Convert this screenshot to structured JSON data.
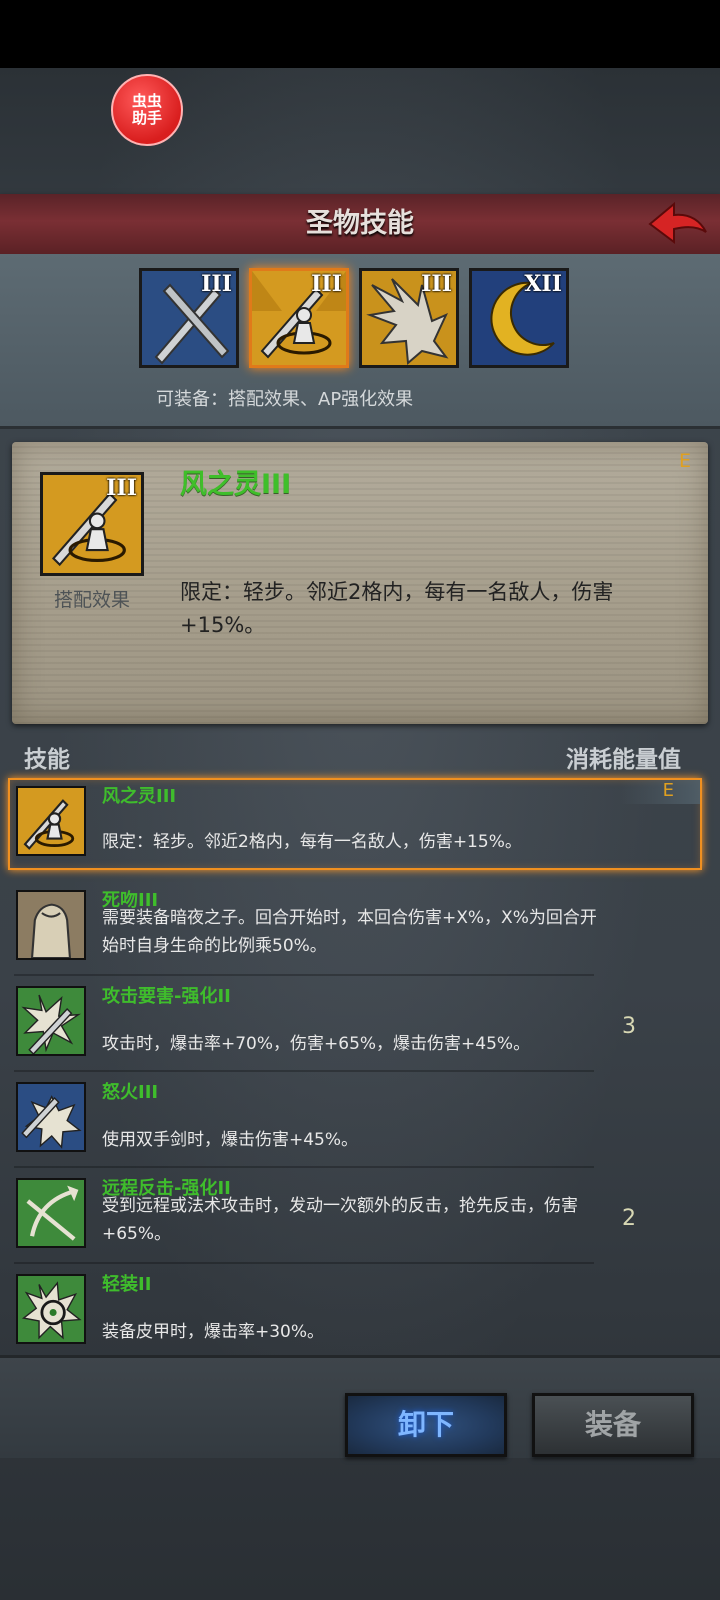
{
  "overlay_badge": {
    "line1": "虫虫",
    "line2": "助手"
  },
  "header": {
    "title": "圣物技能"
  },
  "relics": [
    {
      "level": "III",
      "icon": "crossed-swords-icon",
      "selected": false
    },
    {
      "level": "III",
      "icon": "sword-spirit-icon",
      "selected": true
    },
    {
      "level": "III",
      "icon": "spiked-blade-icon",
      "selected": false
    },
    {
      "level": "XII",
      "icon": "crescent-moon-icon",
      "selected": false
    }
  ],
  "equip_note": "可装备：搭配效果、AP强化效果",
  "detail": {
    "icon_level": "III",
    "icon_label": "搭配效果",
    "title": "风之灵III",
    "tag": "E",
    "description": "限定：轻步。邻近2格内，每有一名敌人，伤害+15%。"
  },
  "list_headers": {
    "skill": "技能",
    "cost": "消耗能量值"
  },
  "skills": [
    {
      "name": "风之灵III",
      "desc": "限定：轻步。邻近2格内，每有一名敌人，伤害+15%。",
      "cost": "",
      "tag": "E",
      "icon": "sword-spirit-icon"
    },
    {
      "name": "死吻III",
      "desc": "需要装备暗夜之子。回合开始时，本回合伤害+X%，X%为回合开始时自身生命的比例乘50%。",
      "cost": "",
      "tag": "",
      "icon": "death-kiss-icon"
    },
    {
      "name": "攻击要害-强化II",
      "desc": "攻击时，爆击率+70%，伤害+65%，爆击伤害+45%。",
      "cost": "3",
      "tag": "",
      "icon": "critical-strike-icon"
    },
    {
      "name": "怒火III",
      "desc": "使用双手剑时，爆击伤害+45%。",
      "cost": "",
      "tag": "",
      "icon": "rage-icon"
    },
    {
      "name": "远程反击-强化II",
      "desc": "受到远程或法术攻击时，发动一次额外的反击，抢先反击，伤害+65%。",
      "cost": "2",
      "tag": "",
      "icon": "ranged-counter-icon"
    },
    {
      "name": "轻装II",
      "desc": "装备皮甲时，爆击率+30%。",
      "cost": "",
      "tag": "",
      "icon": "light-armor-icon"
    }
  ],
  "buttons": {
    "unequip": "卸下",
    "equip": "装备"
  }
}
